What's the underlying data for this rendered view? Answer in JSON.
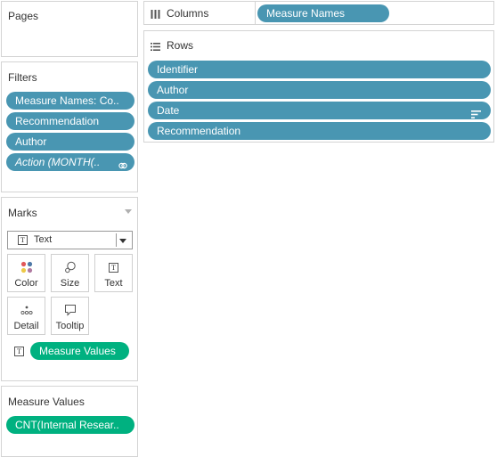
{
  "pages": {
    "title": "Pages"
  },
  "filters": {
    "title": "Filters",
    "items": [
      "Measure Names: Co..",
      "Recommendation",
      "Author",
      "Action (MONTH(.."
    ]
  },
  "marks": {
    "title": "Marks",
    "type_select": "Text",
    "buttons": {
      "color": "Color",
      "size": "Size",
      "text": "Text",
      "detail": "Detail",
      "tooltip": "Tooltip"
    },
    "text_pill": "Measure Values"
  },
  "measure_values": {
    "title": "Measure Values",
    "items": [
      "CNT(Internal Resear.."
    ]
  },
  "columns": {
    "label": "Columns",
    "pills": [
      "Measure Names"
    ]
  },
  "rows": {
    "label": "Rows",
    "pills": [
      "Identifier",
      "Author",
      "Date",
      "Recommendation"
    ]
  },
  "colors": {
    "dimension_pill": "#4996b2",
    "measure_pill": "#00b180",
    "border": "#d4d4d4"
  }
}
